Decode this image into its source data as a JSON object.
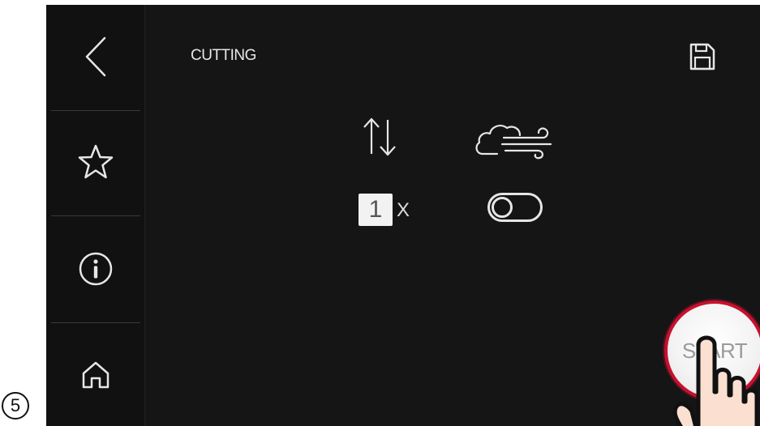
{
  "step": {
    "number": "5"
  },
  "header": {
    "title": "CUTTING"
  },
  "sidebar": {
    "items": [
      {
        "name": "back",
        "icon": "chevron-left-icon"
      },
      {
        "name": "favorites",
        "icon": "star-icon"
      },
      {
        "name": "info",
        "icon": "info-icon"
      },
      {
        "name": "home",
        "icon": "home-icon"
      }
    ]
  },
  "toolbar": {
    "save_icon": "save-icon"
  },
  "settings": {
    "repeat_value": "1",
    "repeat_suffix": "X",
    "air_assist_enabled": false
  },
  "actions": {
    "start_label": "START"
  },
  "colors": {
    "screen_bg": "#151515",
    "accent_red": "#c8102e",
    "icon_light": "#e6e6e6"
  }
}
